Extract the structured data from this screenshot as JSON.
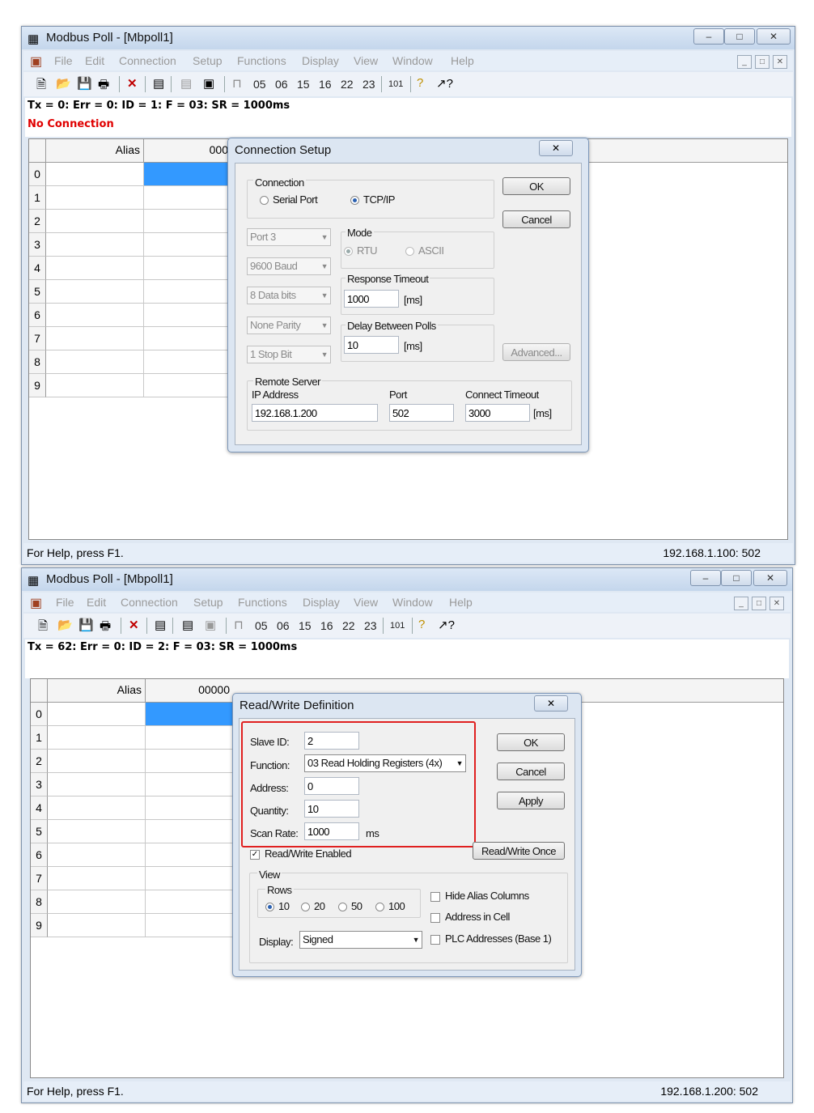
{
  "app_title": "Modbus Poll - [Mbpoll1]",
  "window_buttons": [
    "–",
    "□",
    "✕"
  ],
  "menu": [
    "File",
    "Edit",
    "Connection",
    "Setup",
    "Functions",
    "Display",
    "View",
    "Window",
    "Help"
  ],
  "toolbar": {
    "func_codes": [
      "05",
      "06",
      "15",
      "16",
      "22",
      "23"
    ],
    "poll_101": "101"
  },
  "grid": {
    "alias_header": "Alias",
    "rows": [
      "0",
      "1",
      "2",
      "3",
      "4",
      "5",
      "6",
      "7",
      "8",
      "9"
    ]
  },
  "top": {
    "status_line": "Tx = 0: Err = 0: ID = 1: F = 03: SR = 1000ms",
    "error_line": "No Connection",
    "value_header": "000",
    "status_left": "For Help, press F1.",
    "status_right": "192.168.1.100: 502",
    "dialog": {
      "title": "Connection Setup",
      "connection_label": "Connection",
      "serial_port": "Serial Port",
      "tcpip": "TCP/IP",
      "selected": "TCP/IP",
      "port": "Port 3",
      "baud": "9600 Baud",
      "data_bits": "8 Data bits",
      "parity": "None Parity",
      "stop_bit": "1 Stop Bit",
      "mode_label": "Mode",
      "rtu": "RTU",
      "ascii": "ASCII",
      "response_timeout_label": "Response Timeout",
      "response_timeout": "1000",
      "ms_unit": "[ms]",
      "delay_label": "Delay Between Polls",
      "delay": "10",
      "ok": "OK",
      "cancel": "Cancel",
      "advanced": "Advanced...",
      "remote_server_label": "Remote Server",
      "ip_label": "IP Address",
      "ip": "192.168.1.200",
      "port_label": "Port",
      "tcp_port": "502",
      "connect_timeout_label": "Connect Timeout",
      "connect_timeout": "3000"
    }
  },
  "bottom": {
    "status_line": "Tx = 62: Err = 0: ID = 2: F = 03: SR = 1000ms",
    "value_header": "00000",
    "status_left": "For Help, press F1.",
    "status_right": "192.168.1.200: 502",
    "dialog": {
      "title": "Read/Write Definition",
      "slave_id_label": "Slave ID:",
      "slave_id": "2",
      "function_label": "Function:",
      "function": "03 Read Holding Registers (4x)",
      "address_label": "Address:",
      "address": "0",
      "quantity_label": "Quantity:",
      "quantity": "10",
      "scan_rate_label": "Scan Rate:",
      "scan_rate": "1000",
      "scan_rate_unit": "ms",
      "ok": "OK",
      "cancel": "Cancel",
      "apply": "Apply",
      "rw_once": "Read/Write Once",
      "rw_enabled": "Read/Write Enabled",
      "view_label": "View",
      "rows_label": "Rows",
      "row_options": [
        "10",
        "20",
        "50",
        "100"
      ],
      "rows_selected": "10",
      "hide_alias": "Hide Alias Columns",
      "address_in_cell": "Address in Cell",
      "plc_addresses": "PLC Addresses (Base 1)",
      "display_label": "Display:",
      "display": "Signed"
    },
    "highlight_color": "#e02020"
  },
  "colors": {
    "selected_cell": "#3399ff",
    "error_text": "#e00000"
  }
}
